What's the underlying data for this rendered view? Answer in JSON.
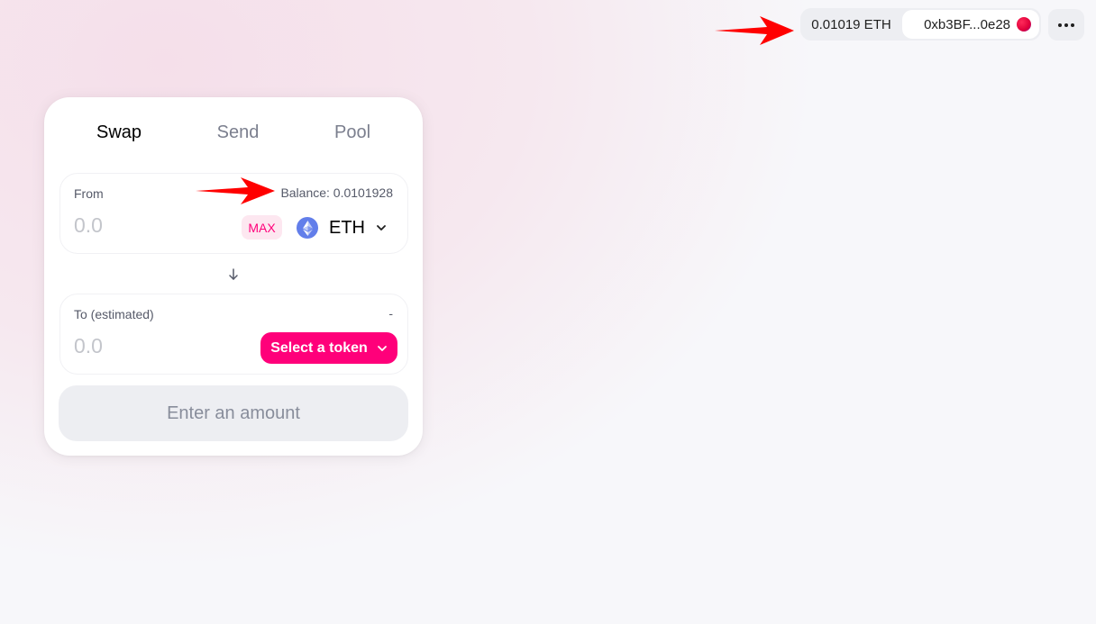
{
  "header": {
    "balance": "0.01019 ETH",
    "address": "0xb3BF...0e28",
    "more_icon": "ellipsis-icon"
  },
  "swap": {
    "tabs": [
      {
        "label": "Swap",
        "active": true
      },
      {
        "label": "Send",
        "active": false
      },
      {
        "label": "Pool",
        "active": false
      }
    ],
    "from": {
      "label": "From",
      "balance": "Balance: 0.0101928",
      "placeholder": "0.0",
      "max_label": "MAX",
      "token": "ETH"
    },
    "to": {
      "label": "To (estimated)",
      "right_text": "-",
      "placeholder": "0.0",
      "select_label": "Select a token"
    },
    "submit_label": "Enter an amount"
  },
  "colors": {
    "accent": "#ff007a",
    "accent_light": "#fde7f0",
    "eth": "#627eea",
    "annotation": "#ff0000"
  }
}
